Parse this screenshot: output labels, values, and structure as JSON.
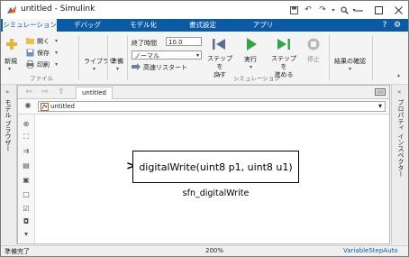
{
  "window": {
    "title": "untitled - Simulink",
    "controls": [
      "minimize-icon",
      "maximize-icon",
      "close-icon"
    ]
  },
  "quick_access": [
    "save-icon",
    "undo-icon",
    "redo-icon",
    "search-icon",
    "help-icon",
    "settings-icon"
  ],
  "tabs": [
    {
      "label": "シミュレーション",
      "active": true
    },
    {
      "label": "デバッグ",
      "active": false
    },
    {
      "label": "モデル化",
      "active": false
    },
    {
      "label": "書式設定",
      "active": false
    },
    {
      "label": "アプリ",
      "active": false
    }
  ],
  "ribbon": {
    "file": {
      "new_label": "新規",
      "open_label": "開く",
      "save_label": "保存",
      "print_label": "印刷",
      "group_label": "ファイル"
    },
    "library": {
      "label": "ライブラリ"
    },
    "prepare": {
      "label": "準備"
    },
    "simulation": {
      "stop_time_label": "終了時間",
      "stop_time_value": "10.0",
      "mode_value": "ノーマル",
      "fast_restart_label": "高速リスタート",
      "step_back_label": "ステップを\n戻す",
      "run_label": "実行",
      "step_forward_label": "ステップを\n進める",
      "stop_label": "停止",
      "group_label": "シミュレーション"
    },
    "review": {
      "label": "結果の確認"
    }
  },
  "side_panels": {
    "left_label": "モデル ブラウザー",
    "right_label": "プロパティ インスペクター"
  },
  "document": {
    "tab_label": "untitled",
    "address": "untitled"
  },
  "palette_icons": [
    "zoom-in-icon",
    "fit-to-view-icon",
    "arrow-route-icon",
    "annotation-icon",
    "image-icon",
    "area-icon",
    "checkbox-icon",
    "camera-icon",
    "more-icon"
  ],
  "block": {
    "text": "digitalWrite(uint8 p1, uint8 u1)",
    "name": "sfn_digitalWrite"
  },
  "status": {
    "left": "準備完了",
    "zoom": "200%",
    "solver": "VariableStepAuto"
  },
  "colors": {
    "tab_bar": "#0a5aa5",
    "solver_link": "#0a5aa5"
  }
}
